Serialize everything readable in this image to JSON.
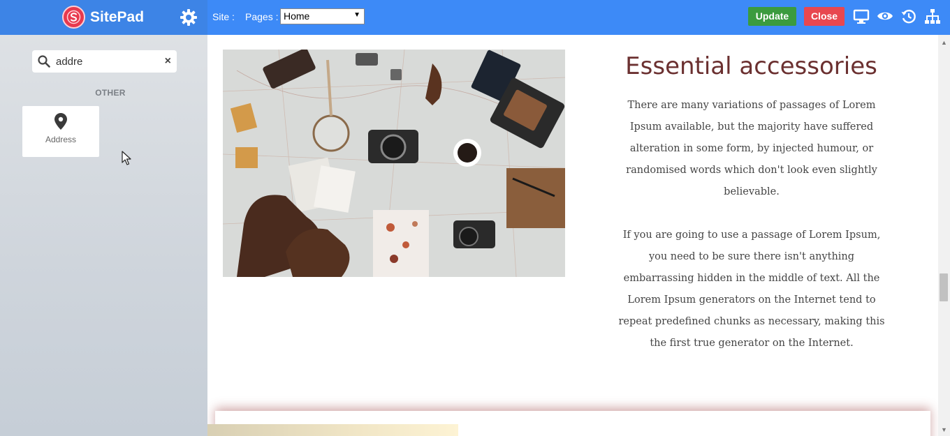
{
  "app": {
    "name": "SitePad"
  },
  "sidebar": {
    "search": {
      "value": "addre",
      "placeholder": "",
      "clear_symbol": "×"
    },
    "category": "OTHER",
    "widgets": [
      {
        "label": "Address",
        "icon": "map-marker-icon"
      }
    ]
  },
  "toolbar": {
    "site_label": "Site :",
    "pages_label": "Pages :",
    "pages_selected": "Home",
    "update_label": "Update",
    "close_label": "Close",
    "icons": [
      "desktop-icon",
      "eye-icon",
      "history-icon",
      "sitemap-icon"
    ]
  },
  "content": {
    "heading": "Essential accessories",
    "paragraphs": [
      "There are many variations of passages of Lorem Ipsum available, but the majority have suffered alteration in some form, by injected humour, or randomised words which don't look even slightly believable.",
      "If you are going to use a passage of Lorem Ipsum, you need to be sure there isn't anything embarrassing hidden in the middle of text. All the Lorem Ipsum generators on the Internet tend to repeat predefined chunks as necessary, making this the first true generator on the Internet."
    ]
  },
  "colors": {
    "topbar": "#3d8af7",
    "brand": "#3d84e6",
    "update": "#3b9b3e",
    "close": "#e8474f",
    "heading": "#6b3030"
  }
}
